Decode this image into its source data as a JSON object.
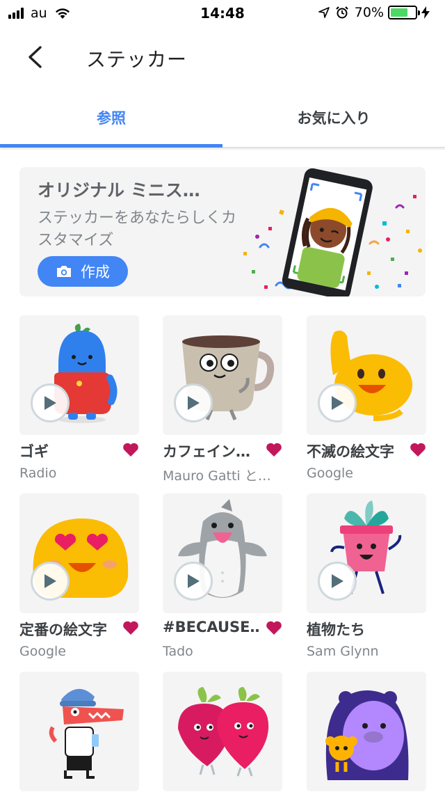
{
  "status_bar": {
    "carrier": "au",
    "time": "14:48",
    "battery": "70%",
    "battery_level": 0.7
  },
  "app_bar": {
    "title": "ステッカー"
  },
  "tabs": [
    {
      "label": "参照",
      "active": true
    },
    {
      "label": "お気に入り",
      "active": false
    }
  ],
  "banner": {
    "title": "オリジナル ミニス…",
    "subtitle": "ステッカーをあなたらしくカスタマイズ",
    "button_label": "作成"
  },
  "stickers": [
    {
      "name": "ゴギ",
      "author": "Radio",
      "favorite": true
    },
    {
      "name": "カフェイン…",
      "author": "Mauro Gatti と…",
      "favorite": true
    },
    {
      "name": "不滅の絵文字",
      "author": "Google",
      "favorite": true
    },
    {
      "name": "定番の絵文字",
      "author": "Google",
      "favorite": true
    },
    {
      "name": "#BECAUSE…",
      "author": "Tado",
      "favorite": true
    },
    {
      "name": "植物たち",
      "author": "Sam Glynn",
      "favorite": false
    },
    {
      "name": "",
      "author": "",
      "favorite": false
    },
    {
      "name": "",
      "author": "",
      "favorite": false
    },
    {
      "name": "",
      "author": "",
      "favorite": false
    }
  ],
  "colors": {
    "accent": "#4285f4",
    "heart": "#c2185b",
    "card_bg": "#f4f4f4"
  }
}
